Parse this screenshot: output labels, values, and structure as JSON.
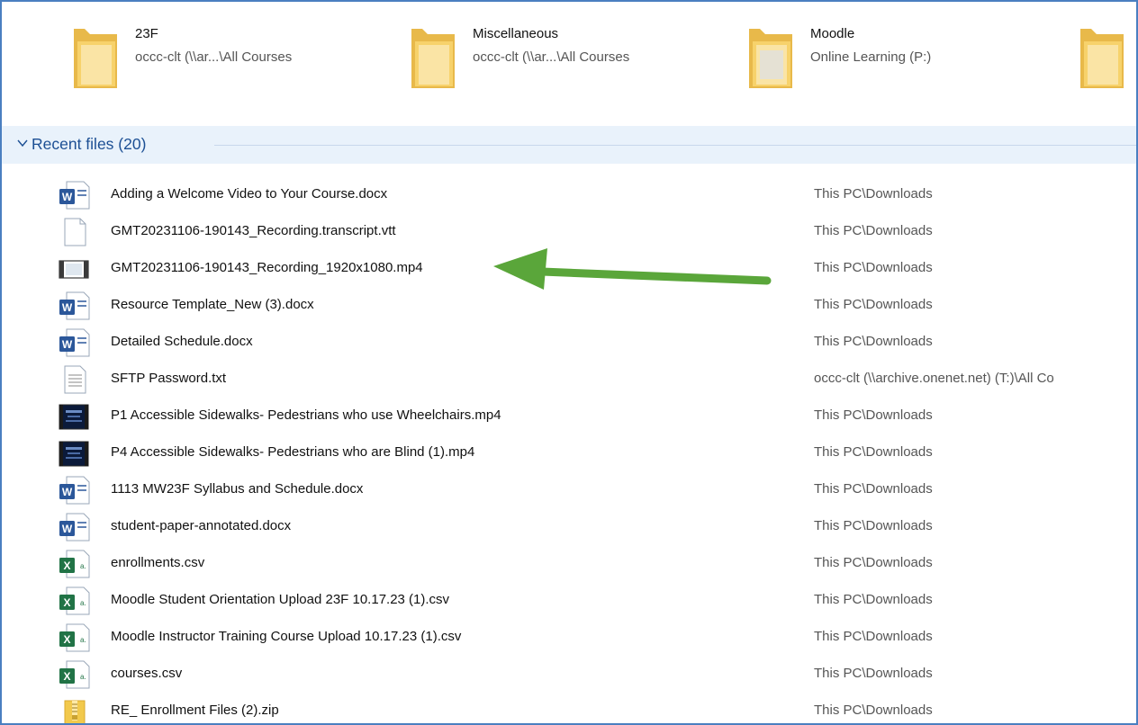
{
  "quick_access": [
    {
      "name": "23F",
      "path": "occc-clt (\\\\ar...\\All Courses",
      "icon": "folder-icon"
    },
    {
      "name": "Miscellaneous",
      "path": "occc-clt (\\\\ar...\\All Courses",
      "icon": "folder-icon"
    },
    {
      "name": "Moodle",
      "path": "Online Learning (P:)",
      "icon": "folder-icon"
    },
    {
      "name": "",
      "path": "",
      "icon": "folder-icon"
    }
  ],
  "recent": {
    "title": "Recent files (20)",
    "files": [
      {
        "name": "Adding a Welcome Video to Your Course.docx",
        "location": "This PC\\Downloads",
        "icon": "word-doc-icon"
      },
      {
        "name": "GMT20231106-190143_Recording.transcript.vtt",
        "location": "This PC\\Downloads",
        "icon": "blank-file-icon"
      },
      {
        "name": "GMT20231106-190143_Recording_1920x1080.mp4",
        "location": "This PC\\Downloads",
        "icon": "video-file-icon"
      },
      {
        "name": "Resource Template_New (3).docx",
        "location": "This PC\\Downloads",
        "icon": "word-doc-icon"
      },
      {
        "name": "Detailed Schedule.docx",
        "location": "This PC\\Downloads",
        "icon": "word-doc-icon"
      },
      {
        "name": "SFTP Password.txt",
        "location": "occc-clt (\\\\archive.onenet.net) (T:)\\All Co",
        "icon": "text-file-icon"
      },
      {
        "name": "P1 Accessible Sidewalks- Pedestrians who use Wheelchairs.mp4",
        "location": "This PC\\Downloads",
        "icon": "video-thumbnail-icon"
      },
      {
        "name": "P4 Accessible Sidewalks- Pedestrians who are Blind (1).mp4",
        "location": "This PC\\Downloads",
        "icon": "video-thumbnail-icon"
      },
      {
        "name": "1113 MW23F Syllabus and Schedule.docx",
        "location": "This PC\\Downloads",
        "icon": "word-doc-icon"
      },
      {
        "name": "student-paper-annotated.docx",
        "location": "This PC\\Downloads",
        "icon": "word-doc-icon"
      },
      {
        "name": "enrollments.csv",
        "location": "This PC\\Downloads",
        "icon": "excel-csv-icon"
      },
      {
        "name": "Moodle Student Orientation Upload 23F 10.17.23 (1).csv",
        "location": "This PC\\Downloads",
        "icon": "excel-csv-icon"
      },
      {
        "name": "Moodle Instructor Training Course Upload 10.17.23 (1).csv",
        "location": "This PC\\Downloads",
        "icon": "excel-csv-icon"
      },
      {
        "name": "courses.csv",
        "location": "This PC\\Downloads",
        "icon": "excel-csv-icon"
      },
      {
        "name": "RE_ Enrollment Files (2).zip",
        "location": "This PC\\Downloads",
        "icon": "zip-folder-icon"
      }
    ]
  },
  "colors": {
    "accent": "#1c4f94",
    "header_bg": "#e9f2fb",
    "frame_border": "#4a7fc0",
    "arrow": "#5aa63a",
    "word": "#2b579a",
    "excel": "#217346",
    "folder": "#f7d26b"
  }
}
